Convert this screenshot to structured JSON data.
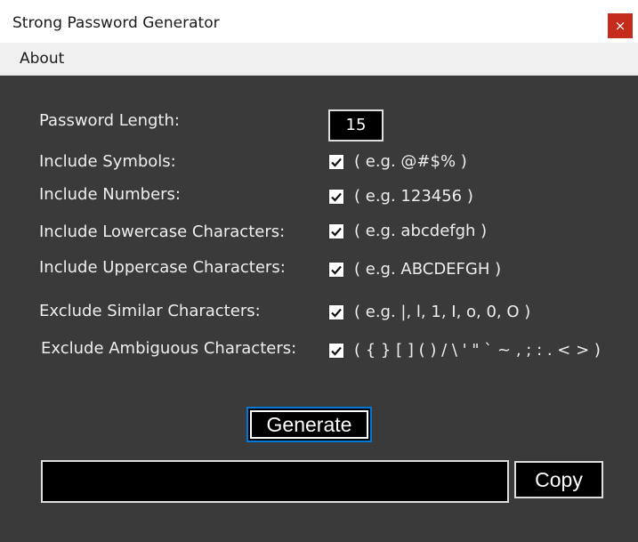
{
  "window": {
    "title": "Strong Password Generator",
    "close_label": "×"
  },
  "menu": {
    "items": [
      {
        "label": "About"
      }
    ]
  },
  "form": {
    "password_length": {
      "label": "Password Length:",
      "value": "15"
    },
    "options": [
      {
        "label": "Include Symbols:",
        "checked": true,
        "example": "( e.g. @#$% )"
      },
      {
        "label": "Include Numbers:",
        "checked": true,
        "example": "( e.g. 123456 )"
      },
      {
        "label": "Include Lowercase Characters:",
        "checked": true,
        "example": "( e.g. abcdefgh )"
      },
      {
        "label": "Include Uppercase Characters:",
        "checked": true,
        "example": "( e.g. ABCDEFGH )"
      },
      {
        "label": "Exclude Similar Characters:",
        "checked": true,
        "example": "( e.g.  |, l, 1, I, o, 0, O )"
      },
      {
        "label": "Exclude Ambiguous Characters:",
        "checked": true,
        "example": "( { } [ ] ( ) / \\ ' \" ` ~ , ; : . < > )"
      }
    ]
  },
  "actions": {
    "generate_label": "Generate",
    "copy_label": "Copy",
    "output_value": ""
  },
  "icons": {
    "close": "close-icon",
    "checkbox": "checkmark-icon"
  },
  "colors": {
    "background": "#3a3a3a",
    "titlebar": "#ffffff",
    "menubar": "#f0f0f0",
    "close_button": "#c42b1c",
    "focus_border": "#0078d7"
  }
}
